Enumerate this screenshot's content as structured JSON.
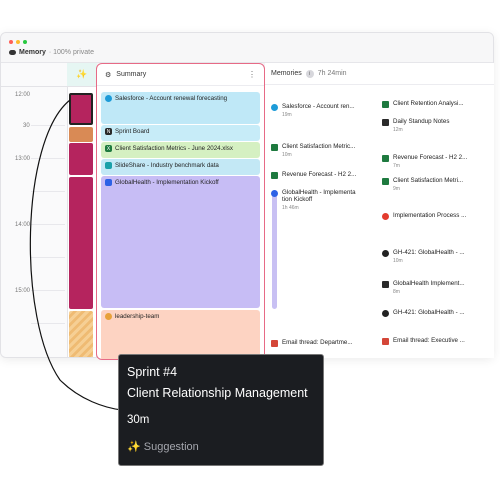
{
  "window": {
    "dots": [
      "#ff5f57",
      "#febc2e",
      "#28c840"
    ],
    "title": "Memory",
    "privacy": "· 100% private"
  },
  "timeline": {
    "hours": [
      "12:00",
      "13:00",
      "14:00",
      "15:00"
    ],
    "half_label": "30"
  },
  "summary": {
    "title": "Summary",
    "cards": [
      {
        "label": "Salesforce - Account renewal forecasting",
        "icon": "salesforce-icon",
        "color": "#bfe8f7"
      },
      {
        "label": "Sprint Board",
        "icon": "notion-icon",
        "color": "#c7ecf8"
      },
      {
        "label": "Client Satisfaction Metrics - June 2024.xlsx",
        "icon": "excel-icon",
        "color": "#d5f0c2"
      },
      {
        "label": "SlideShare - Industry benchmark data",
        "icon": "slideshare-icon",
        "color": "#c3e8f5"
      },
      {
        "label": "GlobalHealth - Implementation Kickoff",
        "icon": "zoom-icon",
        "color": "#c7bdf5"
      },
      {
        "label": "leadership-team",
        "icon": "slack-icon",
        "color": "#fdd3c2"
      }
    ]
  },
  "memories": {
    "title": "Memories",
    "duration": "7h 24min",
    "left": [
      {
        "label": "Salesforce - Account ren...",
        "sub": "19m",
        "icon": "salesforce-icon"
      },
      {
        "label": "Client Satisfaction Metric...",
        "sub": "10m",
        "icon": "excel-icon"
      },
      {
        "label": "Revenue Forecast - H2 2...",
        "sub": "",
        "icon": "excel-icon"
      },
      {
        "label": "GlobalHealth - Implementa tion Kickoff",
        "sub": "1h 46m",
        "icon": "zoom-icon"
      },
      {
        "label": "Email thread: Departme...",
        "sub": "",
        "icon": "gmail-icon"
      }
    ],
    "right": [
      {
        "label": "Client Retention Analysi...",
        "sub": "",
        "icon": "excel-icon"
      },
      {
        "label": "Daily Standup Notes",
        "sub": "12m",
        "icon": "notion-icon"
      },
      {
        "label": "Revenue Forecast - H2 2...",
        "sub": "7m",
        "icon": "excel-icon"
      },
      {
        "label": "Client Satisfaction Metri...",
        "sub": "9m",
        "icon": "excel-icon"
      },
      {
        "label": "Implementation Process ...",
        "sub": "",
        "icon": "chrome-icon"
      },
      {
        "label": "GH-421: GlobalHealth - ...",
        "sub": "10m",
        "icon": "github-icon"
      },
      {
        "label": "GlobalHealth Implement...",
        "sub": "8m",
        "icon": "notion-icon"
      },
      {
        "label": "GH-421: GlobalHealth - ...",
        "sub": "",
        "icon": "github-icon"
      },
      {
        "label": "Email thread: Executive ...",
        "sub": "",
        "icon": "gmail-icon"
      }
    ]
  },
  "tooltip": {
    "sprint": "Sprint #4",
    "title": "Client Relationship Management",
    "duration": "30m",
    "tag": "✨ Suggestion"
  },
  "colors": {
    "accent": "#e76a86",
    "suggestion_magenta": "#b5245e",
    "suggestion_orange": "#d98a55",
    "suggestion_striped": "#f6cf94"
  }
}
